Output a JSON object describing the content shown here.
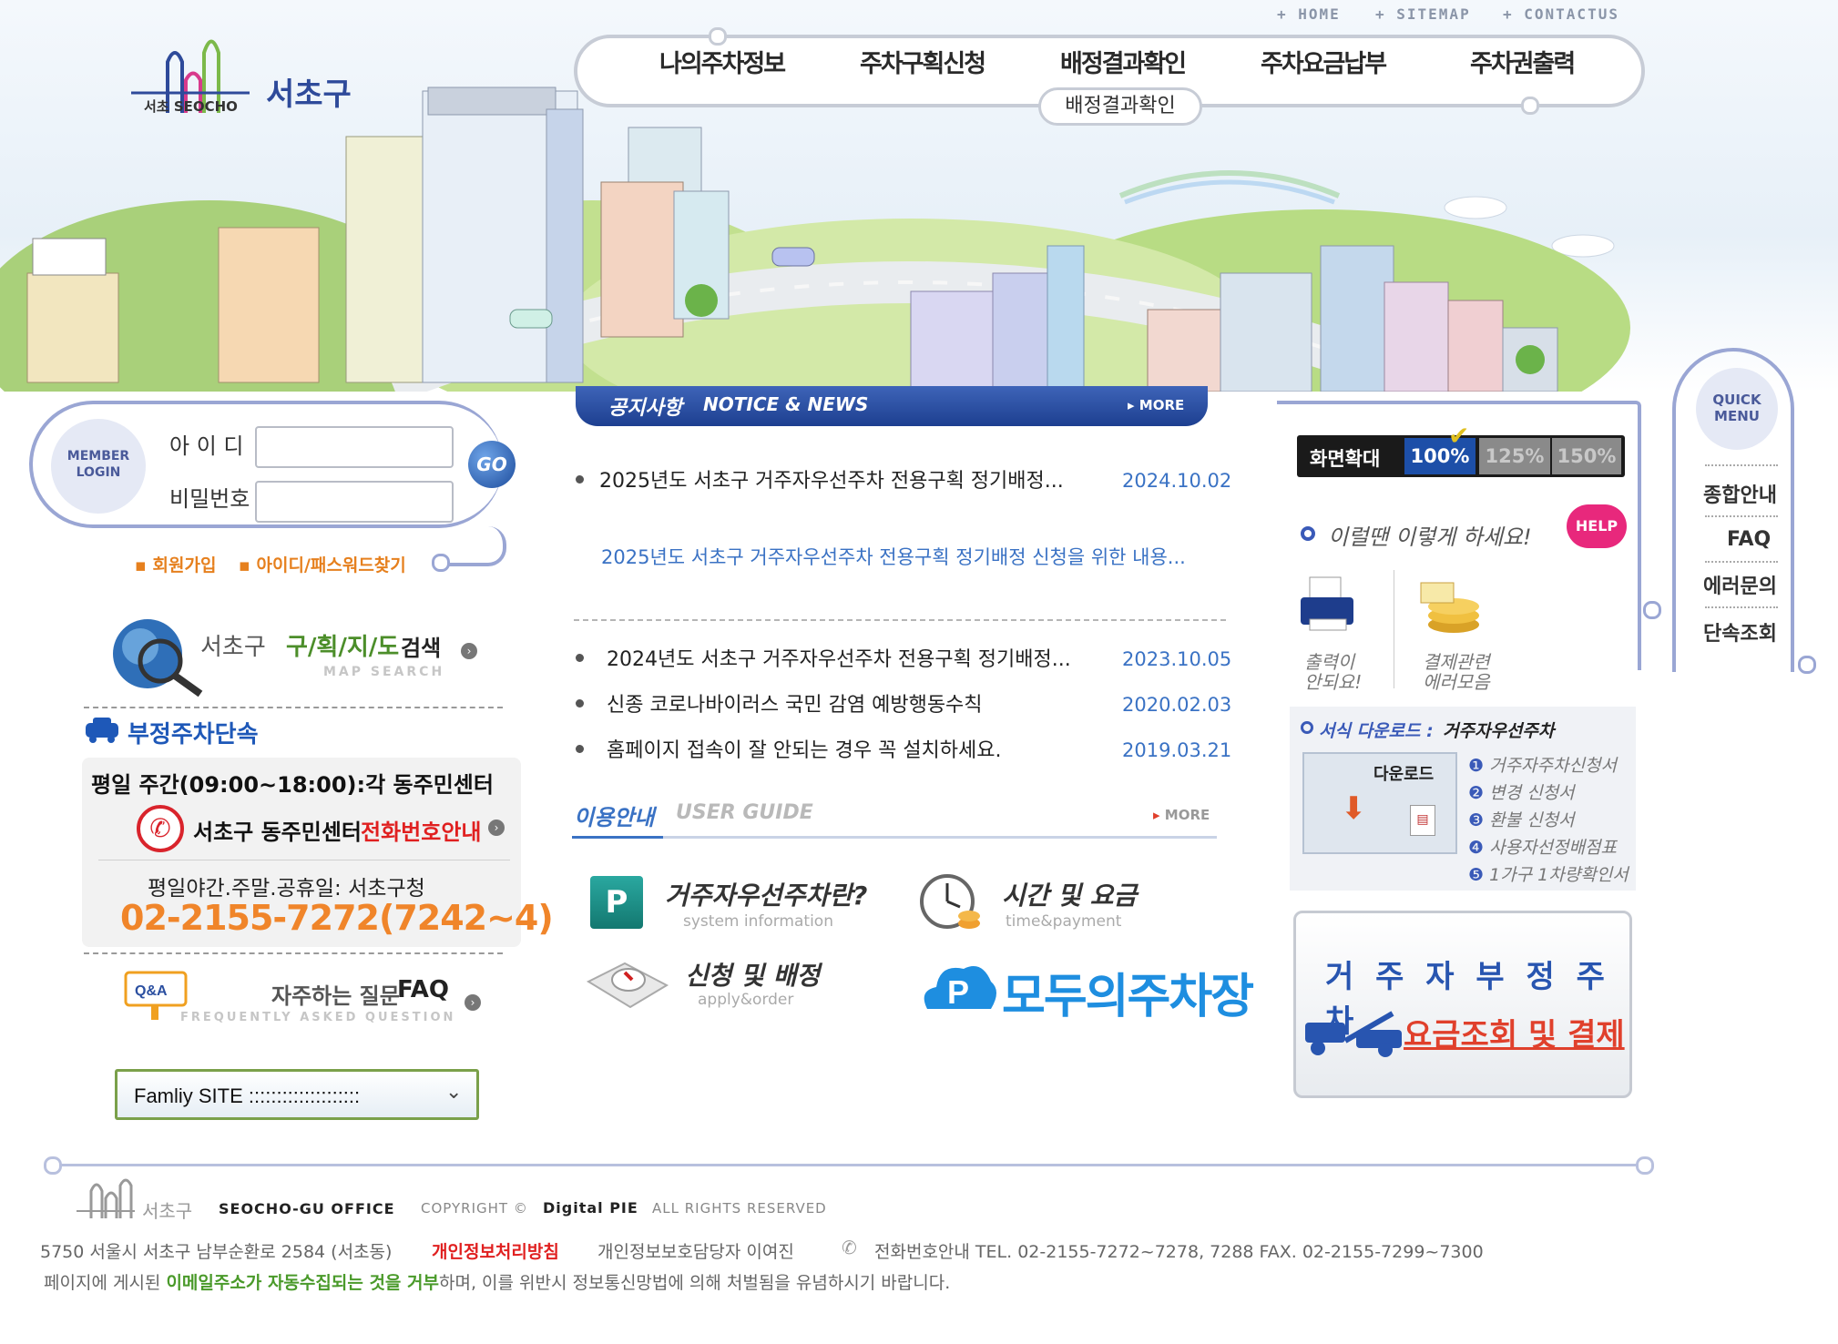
{
  "utility_nav": [
    "+ HOME",
    "+ SITEMAP",
    "+ CONTACTUS"
  ],
  "logo": {
    "name": "서초구",
    "sub": "서초 SEOCHO"
  },
  "gnb": {
    "items": [
      "나의주차정보",
      "주차구획신청",
      "배정결과확인",
      "주차요금납부",
      "주차권출력"
    ],
    "active_sub": "배정결과확인"
  },
  "login": {
    "badge_line1": "MEMBER",
    "badge_line2": "LOGIN",
    "id_label": "아 이 디",
    "pw_label": "비밀번호",
    "go_label": "GO",
    "join_link": "회원가입",
    "find_link": "아이디/패스워드찾기"
  },
  "map_search": {
    "title": "서초구",
    "title2": "구/획/지/도",
    "title3": "검색",
    "sub": "MAP SEARCH"
  },
  "illegal": {
    "title": "부정주차단속",
    "weekday": "평일 주간(09:00~18:00):각 동주민센터",
    "center_title": "서초구 동주민센터",
    "center_link": "전화번호안내",
    "night": "평일야간.주말.공휴일: 서초구청",
    "phone": "02-2155-7272(7242~4)"
  },
  "faq": {
    "badge": "Q&A",
    "title": "자주하는 질문",
    "title_en": "FAQ",
    "sub": "FREQUENTLY ASKED QUESTION"
  },
  "family_site": {
    "selected": "Famliy SITE ::::::::::::::::::::"
  },
  "notice": {
    "title_kr": "공지사항",
    "title_en": "NOTICE & NEWS",
    "more": "MORE",
    "featured": {
      "title": "2025년도 서초구 거주자우선주차 전용구획 정기배정...",
      "date": "2024.10.02",
      "summary": "2025년도 서초구 거주자우선주차 전용구획 정기배정 신청을 위한 내용..."
    },
    "items": [
      {
        "title": "2024년도 서초구 거주자우선주차 전용구획 정기배정...",
        "date": "2023.10.05"
      },
      {
        "title": "신종 코로나바이러스 국민 감염 예방행동수칙",
        "date": "2020.02.03"
      },
      {
        "title": "홈페이지 접속이 잘 안되는 경우 꼭 설치하세요.",
        "date": "2019.03.21"
      }
    ]
  },
  "guide": {
    "title_kr": "이용안내",
    "title_en": "USER GUIDE",
    "more": "MORE",
    "items": [
      {
        "title": "거주자우선주차란?",
        "sub": "system information"
      },
      {
        "title": "시간 및 요금",
        "sub": "time&payment"
      },
      {
        "title": "신청 및 배정",
        "sub": "apply&order"
      }
    ],
    "banner": "모두의주차장"
  },
  "zoom": {
    "label": "화면확대",
    "options": [
      "100%",
      "125%",
      "150%"
    ],
    "selected": "100%"
  },
  "help": {
    "title": "이럴땐 이렇게 하세요!",
    "badge": "HELP",
    "item1": [
      "출력이",
      "안되요!"
    ],
    "item2": [
      "결제관련",
      "에러모음"
    ]
  },
  "download": {
    "title": "서식 다운로드 :",
    "category": "거주자우선주차",
    "button": "다운로드",
    "items": [
      "거주자주차신청서",
      "변경 신청서",
      "환불 신청서",
      "사용자선정배점표",
      "1가구 1차량확인서"
    ]
  },
  "illegal_banner": {
    "line1": "거 주 자 부 정 주 차",
    "line2": "요금조회 및 결제"
  },
  "quick_menu": {
    "title1": "QUICK",
    "title2": "MENU",
    "items": [
      "종합안내",
      "FAQ",
      "에러문의",
      "단속조회"
    ]
  },
  "footer": {
    "office": "SEOCHO-GU OFFICE",
    "name": "서초구",
    "copyright": "COPYRIGHT ©",
    "company": "Digital PIE",
    "rights": "ALL RIGHTS RESERVED",
    "address": "5750 서울시 서초구 남부순환로 2584 (서초동)",
    "privacy": "개인정보처리방침",
    "manager": "개인정보보호담당자  이여진",
    "tel": "전화번호안내  TEL. 02-2155-7272~7278, 7288   FAX. 02-2155-7299~7300",
    "notice_pre": "페이지에 게시된",
    "notice_em": "이메일주소가 자동수집되는 것을 거부",
    "notice_post": "하며, 이를 위반시 정보통신망법에 의해 처벌됨을 유념하시기 바랍니다."
  }
}
